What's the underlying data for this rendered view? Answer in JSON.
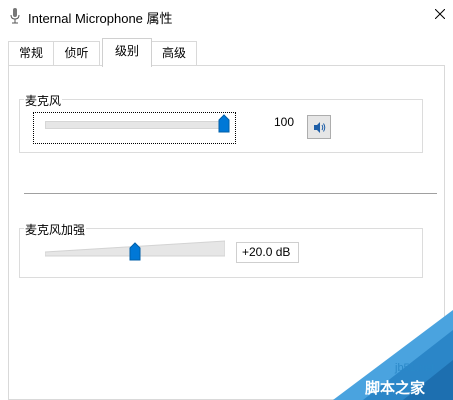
{
  "window": {
    "title": "Internal Microphone 属性",
    "close_icon": "close-icon",
    "app_icon": "microphone-icon"
  },
  "tabs": [
    {
      "label": "常规",
      "active": false
    },
    {
      "label": "侦听",
      "active": false
    },
    {
      "label": "级别",
      "active": true
    },
    {
      "label": "高级",
      "active": false
    }
  ],
  "microphone": {
    "label": "麦克风",
    "value_text": "100",
    "level_percent": 100,
    "mute_icon": "speaker-icon"
  },
  "boost": {
    "label": "麦克风加强",
    "value_text": "+20.0 dB",
    "level_fraction": 0.5
  },
  "watermark": {
    "url": "jb51.net",
    "text": "脚本之家"
  },
  "colors": {
    "accent": "#0078d7",
    "watermark": "#2a88c8"
  }
}
